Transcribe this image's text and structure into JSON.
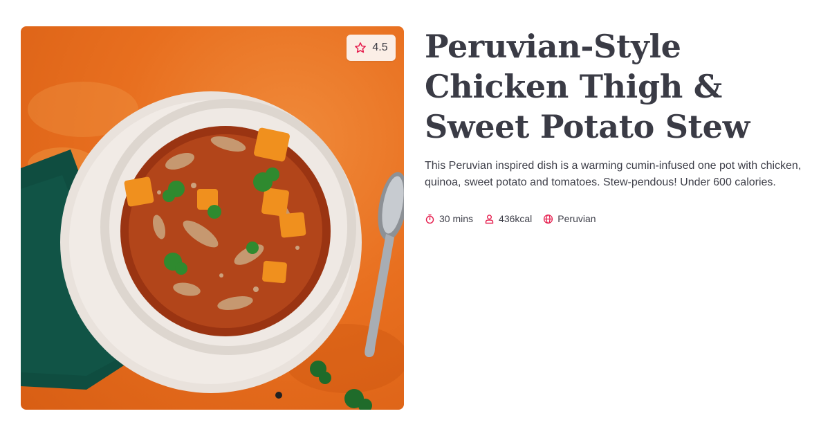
{
  "recipe": {
    "title": "Peruvian-Style Chicken Thigh & Sweet Potato Stew",
    "description": "This Peruvian inspired dish is a warming cumin-infused one pot with chicken, quinoa, sweet potato and tomatoes. Stew-pendous! Under 600 calories.",
    "rating": "4.5",
    "meta": {
      "time": "30 mins",
      "calories": "436kcal",
      "cuisine": "Peruvian"
    }
  },
  "icons": {
    "rating": "star-icon",
    "time": "timer-icon",
    "calories": "person-icon",
    "cuisine": "globe-icon"
  },
  "colors": {
    "accent": "#e5194a",
    "text": "#3a3b45",
    "image_background": "#e8731f"
  }
}
